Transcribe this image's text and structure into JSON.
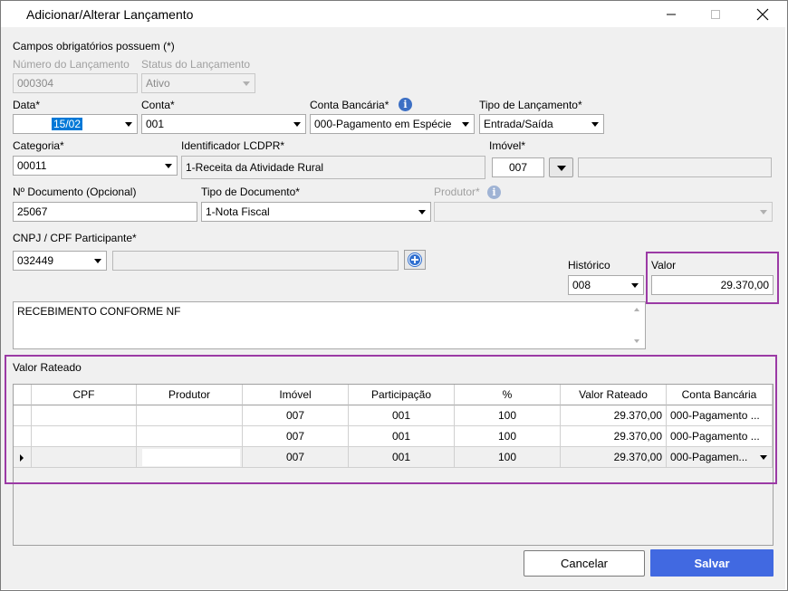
{
  "window": {
    "title": "Adicionar/Alterar Lançamento"
  },
  "form": {
    "required_note": "Campos obrigatórios possuem (*)",
    "numero": {
      "label": "Número do Lançamento",
      "value": "000304"
    },
    "status": {
      "label": "Status do Lançamento",
      "value": "Ativo"
    },
    "data": {
      "label": "Data*",
      "value": "15/02"
    },
    "conta": {
      "label": "Conta*",
      "value": "001"
    },
    "conta_bancaria": {
      "label": "Conta Bancária*",
      "value": "000-Pagamento em Espécie"
    },
    "tipo_lancamento": {
      "label": "Tipo de Lançamento*",
      "value": "Entrada/Saída"
    },
    "categoria": {
      "label": "Categoria*",
      "value": "00011"
    },
    "identificador": {
      "label": "Identificador LCDPR*",
      "value": "1-Receita da Atividade Rural"
    },
    "imovel": {
      "label": "Imóvel*",
      "value": "007",
      "desc": ""
    },
    "documento": {
      "label": "Nº Documento (Opcional)",
      "value": "25067"
    },
    "tipo_documento": {
      "label": "Tipo de Documento*",
      "value": "1-Nota Fiscal"
    },
    "produtor": {
      "label": "Produtor*",
      "value": ""
    },
    "cnpj": {
      "label": "CNPJ / CPF Participante*",
      "value": "032449",
      "desc": ""
    },
    "historico": {
      "label": "Histórico",
      "value": "008"
    },
    "valor": {
      "label": "Valor",
      "value": "29.370,00"
    },
    "descricao": "RECEBIMENTO CONFORME NF"
  },
  "rateio": {
    "title": "Valor Rateado",
    "columns": [
      "CPF",
      "Produtor",
      "Imóvel",
      "Participação",
      "%",
      "Valor Rateado",
      "Conta Bancária"
    ],
    "rows": [
      [
        "",
        "",
        "007",
        "001",
        "100",
        "29.370,00",
        "000-Pagamento ..."
      ],
      [
        "",
        "",
        "007",
        "001",
        "100",
        "29.370,00",
        "000-Pagamento ..."
      ],
      [
        "",
        "",
        "007",
        "001",
        "100",
        "29.370,00",
        "000-Pagamen..."
      ]
    ]
  },
  "buttons": {
    "cancel": "Cancelar",
    "save": "Salvar"
  },
  "colors": {
    "accent": "#4169e1",
    "highlight": "#9b3aa5",
    "selection": "#0078d7"
  },
  "icons": [
    "info-icon",
    "plus-circle-icon",
    "minimize-icon",
    "maximize-icon",
    "close-icon",
    "row-pointer-icon"
  ]
}
